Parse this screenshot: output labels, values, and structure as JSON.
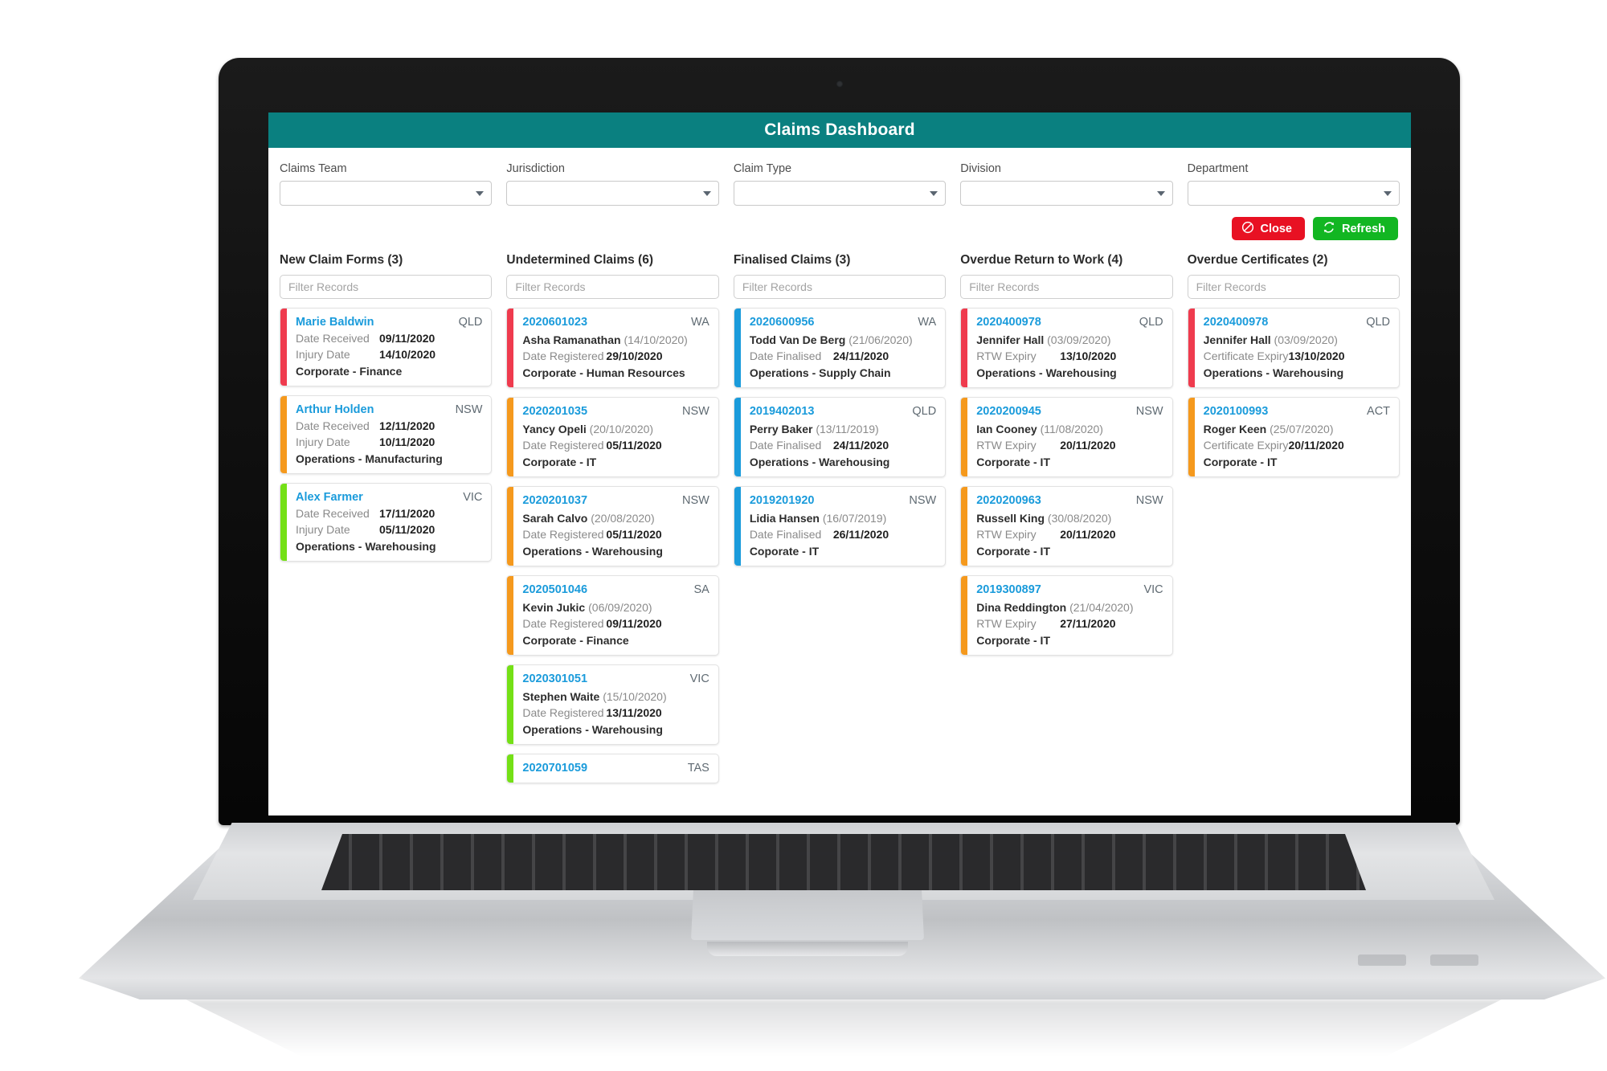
{
  "header": {
    "title": "Claims Dashboard"
  },
  "filters": [
    {
      "label": "Claims Team",
      "value": ""
    },
    {
      "label": "Jurisdiction",
      "value": ""
    },
    {
      "label": "Claim Type",
      "value": ""
    },
    {
      "label": "Division",
      "value": ""
    },
    {
      "label": "Department",
      "value": ""
    }
  ],
  "actions": {
    "close_label": "Close",
    "close_icon": "block-icon",
    "close_color": "#e81123",
    "refresh_label": "Refresh",
    "refresh_icon": "refresh-icon",
    "refresh_color": "#12b622"
  },
  "filter_placeholder": "Filter Records",
  "accent_colors": {
    "red": "#ef3b4e",
    "orange": "#f5991d",
    "green": "#74e016",
    "blue": "#1a9bdb"
  },
  "columns": [
    {
      "title": "New Claim Forms (3)",
      "date_key": "Date Received",
      "cards": [
        {
          "stripe": "#ef3b4e",
          "ref": "Marie Baldwin",
          "state": "QLD",
          "kv1_key": "Date Received",
          "kv1_value": "09/11/2020",
          "kv2_key": "Injury Date",
          "kv2_value": "14/10/2020",
          "dept": "Corporate - Finance"
        },
        {
          "stripe": "#f5991d",
          "ref": "Arthur Holden",
          "state": "NSW",
          "kv1_key": "Date Received",
          "kv1_value": "12/11/2020",
          "kv2_key": "Injury Date",
          "kv2_value": "10/11/2020",
          "dept": "Operations - Manufacturing"
        },
        {
          "stripe": "#74e016",
          "ref": "Alex Farmer",
          "state": "VIC",
          "kv1_key": "Date Received",
          "kv1_value": "17/11/2020",
          "kv2_key": "Injury Date",
          "kv2_value": "05/11/2020",
          "dept": "Operations - Warehousing"
        }
      ]
    },
    {
      "title": "Undetermined Claims (6)",
      "cards": [
        {
          "stripe": "#ef3b4e",
          "ref": "2020601023",
          "state": "WA",
          "person": "Asha Ramanathan",
          "person_date": "(14/10/2020)",
          "kv1_key": "Date Registered",
          "kv1_value": "29/10/2020",
          "dept": "Corporate - Human Resources"
        },
        {
          "stripe": "#f5991d",
          "ref": "2020201035",
          "state": "NSW",
          "person": "Yancy Opeli",
          "person_date": "(20/10/2020)",
          "kv1_key": "Date Registered",
          "kv1_value": "05/11/2020",
          "dept": "Corporate - IT"
        },
        {
          "stripe": "#f5991d",
          "ref": "2020201037",
          "state": "NSW",
          "person": "Sarah Calvo",
          "person_date": "(20/08/2020)",
          "kv1_key": "Date Registered",
          "kv1_value": "05/11/2020",
          "dept": "Operations - Warehousing"
        },
        {
          "stripe": "#f5991d",
          "ref": "2020501046",
          "state": "SA",
          "person": "Kevin Jukic",
          "person_date": "(06/09/2020)",
          "kv1_key": "Date Registered",
          "kv1_value": "09/11/2020",
          "dept": "Corporate - Finance"
        },
        {
          "stripe": "#74e016",
          "ref": "2020301051",
          "state": "VIC",
          "person": "Stephen Waite",
          "person_date": "(15/10/2020)",
          "kv1_key": "Date Registered",
          "kv1_value": "13/11/2020",
          "dept": "Operations - Warehousing"
        },
        {
          "stripe": "#74e016",
          "ref": "2020701059",
          "state": "TAS",
          "person": "",
          "person_date": "",
          "kv1_key": "",
          "kv1_value": "",
          "dept": ""
        }
      ]
    },
    {
      "title": "Finalised Claims (3)",
      "cards": [
        {
          "stripe": "#1a9bdb",
          "ref": "2020600956",
          "state": "WA",
          "person": "Todd Van De Berg",
          "person_date": "(21/06/2020)",
          "kv1_key": "Date Finalised",
          "kv1_value": "24/11/2020",
          "dept": "Operations - Supply Chain"
        },
        {
          "stripe": "#1a9bdb",
          "ref": "2019402013",
          "state": "QLD",
          "person": "Perry Baker",
          "person_date": "(13/11/2019)",
          "kv1_key": "Date Finalised",
          "kv1_value": "24/11/2020",
          "dept": "Operations - Warehousing"
        },
        {
          "stripe": "#1a9bdb",
          "ref": "2019201920",
          "state": "NSW",
          "person": "Lidia Hansen",
          "person_date": "(16/07/2019)",
          "kv1_key": "Date Finalised",
          "kv1_value": "26/11/2020",
          "dept": "Coporate - IT"
        }
      ]
    },
    {
      "title": "Overdue Return to Work (4)",
      "cards": [
        {
          "stripe": "#ef3b4e",
          "ref": "2020400978",
          "state": "QLD",
          "person": "Jennifer Hall",
          "person_date": "(03/09/2020)",
          "kv1_key": "RTW Expiry",
          "kv1_value": "13/10/2020",
          "dept": "Operations - Warehousing"
        },
        {
          "stripe": "#f5991d",
          "ref": "2020200945",
          "state": "NSW",
          "person": "Ian Cooney",
          "person_date": "(11/08/2020)",
          "kv1_key": "RTW Expiry",
          "kv1_value": "20/11/2020",
          "dept": "Corporate - IT"
        },
        {
          "stripe": "#f5991d",
          "ref": "2020200963",
          "state": "NSW",
          "person": "Russell King",
          "person_date": "(30/08/2020)",
          "kv1_key": "RTW Expiry",
          "kv1_value": "20/11/2020",
          "dept": "Corporate - IT"
        },
        {
          "stripe": "#f5991d",
          "ref": "2019300897",
          "state": "VIC",
          "person": "Dina Reddington",
          "person_date": "(21/04/2020)",
          "kv1_key": "RTW Expiry",
          "kv1_value": "27/11/2020",
          "dept": "Corporate - IT"
        }
      ]
    },
    {
      "title": "Overdue Certificates (2)",
      "cards": [
        {
          "stripe": "#ef3b4e",
          "ref": "2020400978",
          "state": "QLD",
          "person": "Jennifer Hall",
          "person_date": "(03/09/2020)",
          "kv1_key": "Certificate Expiry",
          "kv1_value": "13/10/2020",
          "dept": "Operations - Warehousing"
        },
        {
          "stripe": "#f5991d",
          "ref": "2020100993",
          "state": "ACT",
          "person": "Roger Keen",
          "person_date": "(25/07/2020)",
          "kv1_key": "Certificate Expiry",
          "kv1_value": "20/11/2020",
          "dept": "Corporate - IT"
        }
      ]
    }
  ]
}
